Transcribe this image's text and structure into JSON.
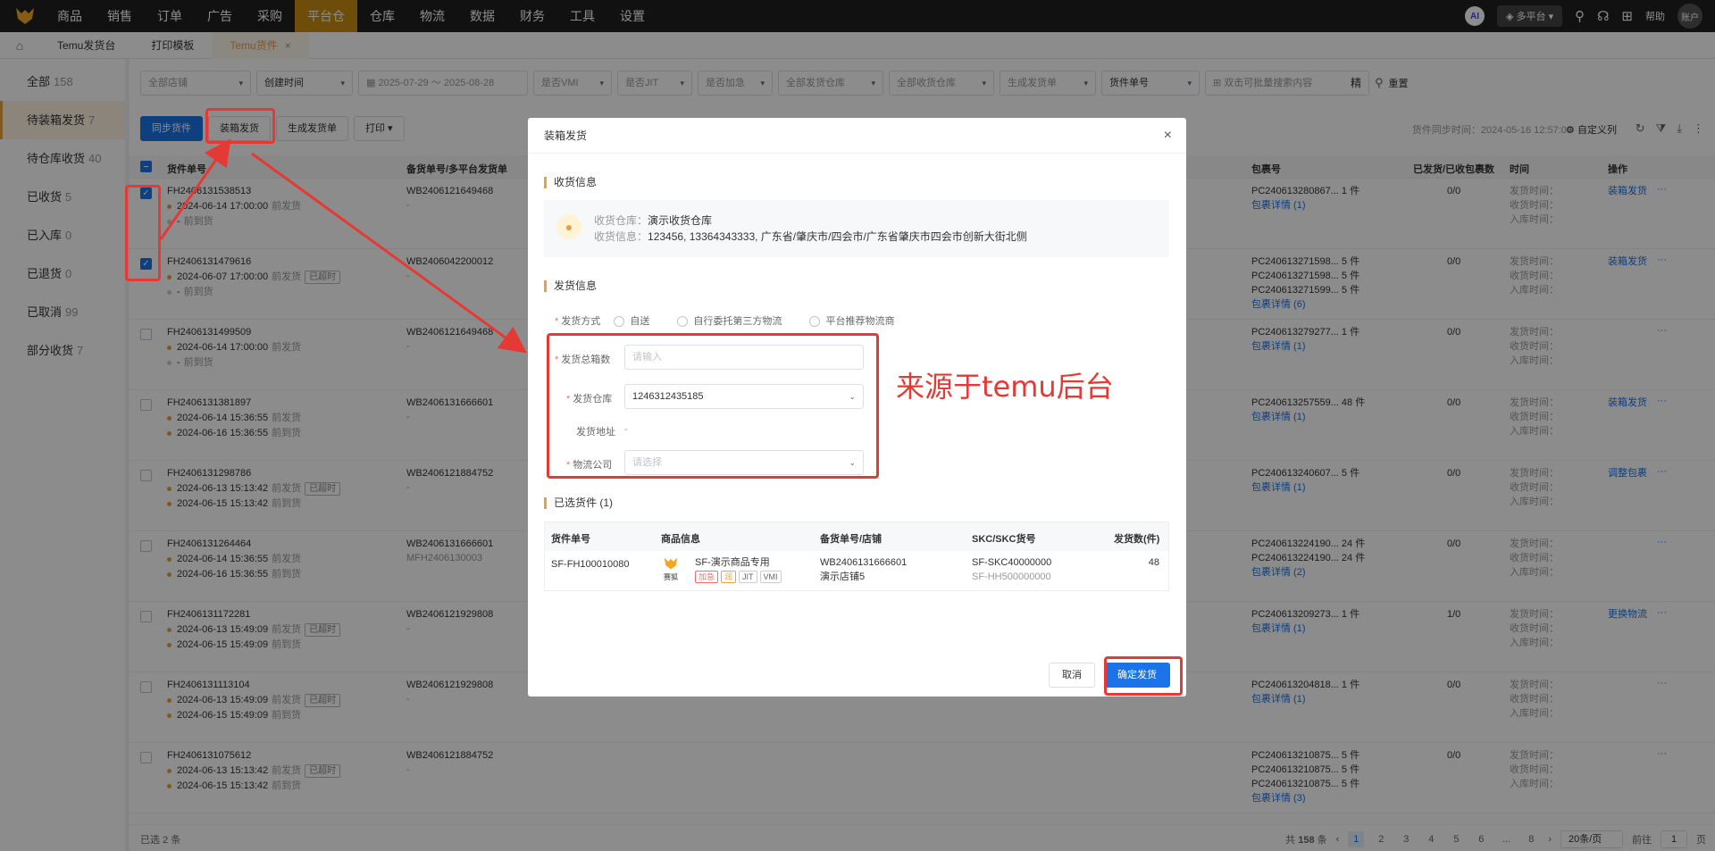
{
  "topnav": {
    "items": [
      "商品",
      "销售",
      "订单",
      "广告",
      "采购",
      "平台仓",
      "仓库",
      "物流",
      "数据",
      "财务",
      "工具",
      "设置"
    ],
    "active_index": 5,
    "ai_label": "AI",
    "platform_label": "多平台",
    "help_label": "帮助",
    "account_label": "账户"
  },
  "tabs": [
    {
      "label": "Temu发货台"
    },
    {
      "label": "打印模板"
    },
    {
      "label": "Temu货件",
      "active": true
    }
  ],
  "sidebar": [
    {
      "label": "全部",
      "count": "158"
    },
    {
      "label": "待装箱发货",
      "count": "7",
      "active": true
    },
    {
      "label": "待仓库收货",
      "count": "40"
    },
    {
      "label": "已收货",
      "count": "5"
    },
    {
      "label": "已入库",
      "count": "0"
    },
    {
      "label": "已退货",
      "count": "0"
    },
    {
      "label": "已取消",
      "count": "99"
    },
    {
      "label": "部分收货",
      "count": "7"
    }
  ],
  "filters": {
    "store": "全部店铺",
    "time_type": "创建时间",
    "date_range": "2025-07-29 ～ 2025-08-28",
    "vmi": "是否VMI",
    "jit": "是否JIT",
    "urgent": "是否加急",
    "ship_wh": "全部发货仓库",
    "recv_wh": "全部收货仓库",
    "gen_ship": "生成发货单",
    "shipment_no": "货件单号",
    "search_ph": "双击可批量搜索内容",
    "exact": "精",
    "reset": "重置"
  },
  "toolbar": {
    "sync": "同步货件",
    "pack": "装箱发货",
    "gen": "生成发货单",
    "print": "打印",
    "sync_time": "货件同步时间：2024-05-16 12:57:00",
    "col_setting": "自定义列"
  },
  "columns": {
    "shipment": "货件单号",
    "stock": "备货单号/多平台发货单",
    "package": "包裹号",
    "shipped": "已发货/已收包裹数",
    "time": "时间",
    "action": "操作"
  },
  "rows": [
    {
      "no": "FH2406131538513",
      "stock": "WB2406121649468",
      "stock2": "-",
      "t1": "2024-06-14 17:00:00",
      "t1tag": "",
      "t2": "-",
      "pkg": [
        "PC240613280867... 1 件"
      ],
      "detail": "包裹详情 (1)",
      "shipped": "0/0",
      "action": "装箱发货",
      "checked": true
    },
    {
      "no": "FH2406131479616",
      "stock": "WB2406042200012",
      "stock2": "-",
      "t1": "2024-06-07 17:00:00",
      "t1tag": "已超时",
      "t2": "-",
      "pkg": [
        "PC240613271598... 5 件",
        "PC240613271598... 5 件",
        "PC240613271599... 5 件"
      ],
      "detail": "包裹详情 (6)",
      "shipped": "0/0",
      "action": "装箱发货",
      "checked": true
    },
    {
      "no": "FH2406131499509",
      "stock": "WB2406121649468",
      "stock2": "-",
      "t1": "2024-06-14 17:00:00",
      "t1tag": "",
      "t2": "-",
      "pkg": [
        "PC240613279277... 1 件"
      ],
      "detail": "包裹详情 (1)",
      "shipped": "0/0",
      "action": "",
      "checked": false
    },
    {
      "no": "FH2406131381897",
      "stock": "WB2406131666601",
      "stock2": "-",
      "t1": "2024-06-14 15:36:55",
      "t1tag": "",
      "t2": "2024-06-16 15:36:55",
      "pkg": [
        "PC240613257559... 48 件"
      ],
      "detail": "包裹详情 (1)",
      "shipped": "0/0",
      "action": "装箱发货",
      "checked": false
    },
    {
      "no": "FH2406131298786",
      "stock": "WB2406121884752",
      "stock2": "-",
      "t1": "2024-06-13 15:13:42",
      "t1tag": "已超时",
      "t2": "2024-06-15 15:13:42",
      "pkg": [
        "PC240613240607... 5 件"
      ],
      "detail": "包裹详情 (1)",
      "shipped": "0/0",
      "action": "调整包裹",
      "checked": false
    },
    {
      "no": "FH2406131264464",
      "stock": "WB2406131666601",
      "stock2": "MFH2406130003",
      "t1": "2024-06-14 15:36:55",
      "t1tag": "",
      "t2": "2024-06-16 15:36:55",
      "pkg": [
        "PC240613224190... 24 件",
        "PC240613224190... 24 件"
      ],
      "detail": "包裹详情 (2)",
      "shipped": "0/0",
      "action": "",
      "checked": false
    },
    {
      "no": "FH2406131172281",
      "stock": "WB2406121929808",
      "stock2": "-",
      "t1": "2024-06-13 15:49:09",
      "t1tag": "已超时",
      "t2": "2024-06-15 15:49:09",
      "pkg": [
        "PC240613209273... 1 件"
      ],
      "detail": "包裹详情 (1)",
      "shipped": "1/0",
      "action": "更换物流",
      "checked": false
    },
    {
      "no": "FH2406131113104",
      "stock": "WB2406121929808",
      "stock2": "-",
      "t1": "2024-06-13 15:49:09",
      "t1tag": "已超时",
      "t2": "2024-06-15 15:49:09",
      "pkg": [
        "PC240613204818... 1 件"
      ],
      "detail": "包裹详情 (1)",
      "shipped": "0/0",
      "action": "",
      "checked": false
    },
    {
      "no": "FH2406131075612",
      "stock": "WB2406121884752",
      "stock2": "-",
      "t1": "2024-06-13 15:13:42",
      "t1tag": "已超时",
      "t2": "2024-06-15 15:13:42",
      "pkg": [
        "PC240613210875... 5 件",
        "PC240613210875... 5 件",
        "PC240613210875... 5 件"
      ],
      "detail": "包裹详情 (3)",
      "shipped": "0/0",
      "action": "",
      "checked": false
    }
  ],
  "row_labels": {
    "ship_time": "前发货",
    "arrive_time": "前到货",
    "time_ship": "发货时间：",
    "time_recv": "收货时间：",
    "time_in": "入库时间："
  },
  "bottom": {
    "selected": "已选 2 条",
    "total_prefix": "共",
    "total": "158",
    "total_suffix": "条",
    "pages": [
      "1",
      "2",
      "3",
      "4",
      "5",
      "6",
      "...",
      "8"
    ],
    "page_size": "20条/页",
    "goto": "前往",
    "goto_page": "1",
    "page_suffix": "页"
  },
  "modal": {
    "title": "装箱发货",
    "recv_section": "收货信息",
    "recv_wh_label": "收货仓库：",
    "recv_wh": "演示收货仓库",
    "recv_info_label": "收货信息：",
    "recv_info": "123456, 13364343333, 广东省/肇庆市/四会市/广东省肇庆市四会市创新大街北侧",
    "ship_section": "发货信息",
    "method_label": "发货方式",
    "methods": [
      "自送",
      "自行委托第三方物流",
      "平台推荐物流商"
    ],
    "boxes_label": "发货总箱数",
    "boxes_ph": "请输入",
    "wh_label": "发货仓库",
    "wh_value": "1246312435185",
    "addr_label": "发货地址",
    "addr_value": "-",
    "carrier_label": "物流公司",
    "carrier_ph": "请选择",
    "selected_section": "已选货件 (1)",
    "table_headers": [
      "货件单号",
      "商品信息",
      "备货单号/店铺",
      "SKC/SKC货号",
      "发货数(件)"
    ],
    "item": {
      "no": "SF-FH100010080",
      "brand": "赛狐",
      "name": "SF-演示商品专用",
      "tags": [
        "加急",
        "润",
        "JIT",
        "VMI"
      ],
      "stock": "WB2406131666601",
      "store": "演示店铺5",
      "skc": "SF-SKC40000000",
      "skc_no": "SF-HH500000000",
      "qty": "48"
    },
    "cancel": "取消",
    "confirm": "确定发货"
  },
  "annotation": "来源于temu后台"
}
